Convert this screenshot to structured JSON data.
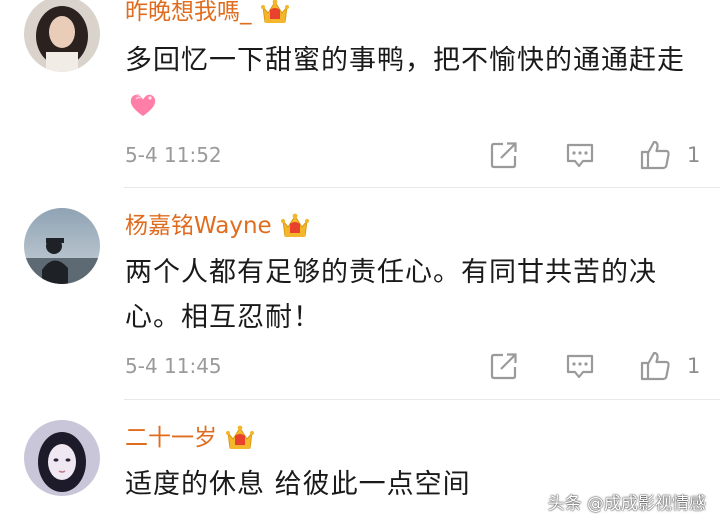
{
  "comments": [
    {
      "username": "昨晚想我嗎_",
      "text": "多回忆一下甜蜜的事鸭，把不愉快的通通赶走",
      "emoji": "heart-emoji",
      "timestamp": "5-4 11:52",
      "like_count": "1"
    },
    {
      "username": "杨嘉铭Wayne",
      "text": "两个人都有足够的责任心。有同甘共苦的决心。相互忍耐！",
      "timestamp": "5-4 11:45",
      "like_count": "1"
    },
    {
      "username": "二十一岁",
      "text": "适度的休息 给彼此一点空间"
    }
  ],
  "icons": {
    "vip_badge": "crown-badge-icon",
    "forward": "forward-icon",
    "reply": "comment-icon",
    "like": "thumbs-up-icon"
  },
  "colors": {
    "username": "#e06d1f",
    "text": "#1a1a1a",
    "meta": "#9a9a9a",
    "badge_gold": "#f4b62a",
    "badge_red": "#e8422e"
  },
  "watermark": "头条 @成成影视情感"
}
